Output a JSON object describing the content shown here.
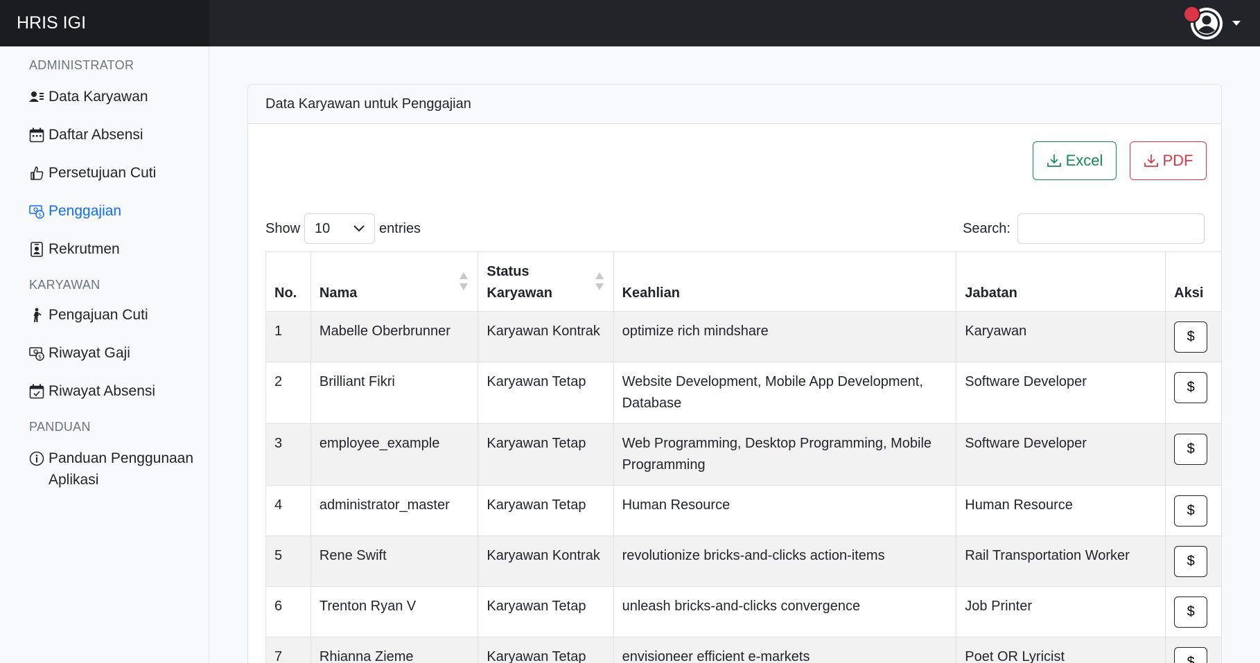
{
  "brand": "HRIS IGI",
  "colors": {
    "navbar": "#212529",
    "accent": "#0d6efd",
    "excel": "#198754",
    "pdf": "#dc3545"
  },
  "sidebar": {
    "sections": [
      {
        "heading": "ADMINISTRATOR"
      },
      {
        "heading": "KARYAWAN"
      },
      {
        "heading": "PANDUAN"
      }
    ],
    "items": [
      {
        "label": "Data Karyawan",
        "icon": "person-lines-icon"
      },
      {
        "label": "Daftar Absensi",
        "icon": "calendar-icon"
      },
      {
        "label": "Persetujuan Cuti",
        "icon": "thumbs-up-icon"
      },
      {
        "label": "Penggajian",
        "icon": "cash-coin-icon",
        "active": true
      },
      {
        "label": "Rekrutmen",
        "icon": "person-badge-icon"
      },
      {
        "label": "Pengajuan Cuti",
        "icon": "person-walking-icon"
      },
      {
        "label": "Riwayat Gaji",
        "icon": "cash-coin-icon"
      },
      {
        "label": "Riwayat Absensi",
        "icon": "calendar-check-icon"
      },
      {
        "label": "Panduan Penggunaan Aplikasi",
        "icon": "info-circle-icon"
      }
    ]
  },
  "card": {
    "title": "Data Karyawan untuk Penggajian",
    "excel_label": "Excel",
    "pdf_label": "PDF",
    "show_label": "Show",
    "entries_value": "10",
    "entries_label": "entries",
    "search_label": "Search:",
    "search_value": ""
  },
  "table": {
    "headers": [
      "No.",
      "Nama",
      "Status Karyawan",
      "Keahlian",
      "Jabatan",
      "Aksi"
    ],
    "action_label": "$",
    "rows": [
      {
        "no": "1",
        "nama": "Mabelle Oberbrunner",
        "status": "Karyawan Kontrak",
        "keahlian": "optimize rich mindshare",
        "jabatan": "Karyawan"
      },
      {
        "no": "2",
        "nama": "Brilliant Fikri",
        "status": "Karyawan Tetap",
        "keahlian": "Website Development, Mobile App Development, Database",
        "jabatan": "Software Developer"
      },
      {
        "no": "3",
        "nama": "employee_example",
        "status": "Karyawan Tetap",
        "keahlian": "Web Programming, Desktop Programming, Mobile Programming",
        "jabatan": "Software Developer"
      },
      {
        "no": "4",
        "nama": "administrator_master",
        "status": "Karyawan Tetap",
        "keahlian": "Human Resource",
        "jabatan": "Human Resource"
      },
      {
        "no": "5",
        "nama": "Rene Swift",
        "status": "Karyawan Kontrak",
        "keahlian": "revolutionize bricks-and-clicks action-items",
        "jabatan": "Rail Transportation Worker"
      },
      {
        "no": "6",
        "nama": "Trenton Ryan V",
        "status": "Karyawan Tetap",
        "keahlian": "unleash bricks-and-clicks convergence",
        "jabatan": "Job Printer"
      },
      {
        "no": "7",
        "nama": "Rhianna Zieme",
        "status": "Karyawan Tetap",
        "keahlian": "envisioneer efficient e-markets",
        "jabatan": "Poet OR Lyricist"
      }
    ]
  }
}
